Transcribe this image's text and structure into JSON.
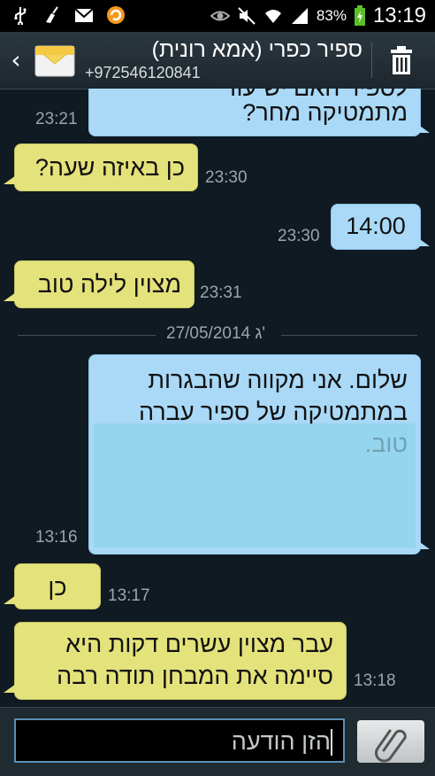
{
  "status_bar": {
    "battery_percent": "83%",
    "time": "13:19"
  },
  "header": {
    "contact_name": "ספיר כפרי (אמא רונית)",
    "contact_number": "+972546120841"
  },
  "messages": [
    {
      "direction": "out",
      "text": "מתמטיקה מחר?",
      "partial_text": "לספיר האם יש עוד",
      "time": "23:21"
    },
    {
      "direction": "in",
      "text": "כן באיזה שעה?",
      "time": "23:30"
    },
    {
      "direction": "out",
      "text": "14:00",
      "time": "23:30"
    },
    {
      "direction": "in",
      "text": "מצוין לילה טוב",
      "time": "23:31"
    },
    {
      "direction": "out",
      "text": "שלום. אני מקווה שהבגרות במתמטיקה של ספיר עברה טוב.",
      "time": "13:16"
    },
    {
      "direction": "in",
      "text": "כן",
      "time": "13:17"
    },
    {
      "direction": "in",
      "text": "עבר מצוין עשרים דקות היא סיימה את המבחן תודה רבה",
      "time": "13:18"
    }
  ],
  "date_separator": "27/05/2014 ג'",
  "composer": {
    "placeholder": "הזן הודעה"
  },
  "colors": {
    "incoming_bubble": "#e4e27a",
    "outgoing_bubble": "#a9d9f7",
    "background": "#0f1a22"
  },
  "icons": [
    "usb-icon",
    "cleaner-icon",
    "gmail-icon",
    "sync-icon",
    "eye-icon",
    "mute-icon",
    "wifi-icon",
    "signal-icon",
    "battery-icon",
    "back-chevron-icon",
    "envelope-icon",
    "trash-icon",
    "paperclip-icon"
  ]
}
